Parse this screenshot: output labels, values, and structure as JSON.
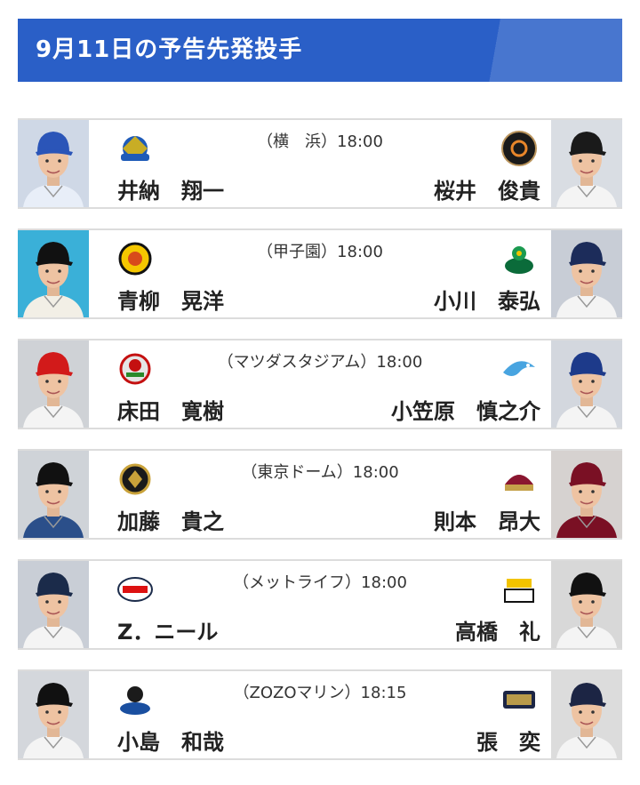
{
  "page_title": "9月11日の予告先発投手",
  "games": [
    {
      "venue": "（横　浜）18:00",
      "home_pitcher": "井納　翔一",
      "away_pitcher": "桜井　俊貴",
      "home_logo": "baystars-logo",
      "away_logo": "giants-logo",
      "home_colors": {
        "cap": "#2b55b8",
        "shirt": "#e8eef8",
        "bg": "#cfd8e6"
      },
      "away_colors": {
        "cap": "#1a1a1a",
        "shirt": "#f4f4f4",
        "bg": "#d9dde3"
      }
    },
    {
      "venue": "（甲子園）18:00",
      "home_pitcher": "青柳　晃洋",
      "away_pitcher": "小川　泰弘",
      "home_logo": "tigers-logo",
      "away_logo": "swallows-logo",
      "home_colors": {
        "cap": "#111111",
        "shirt": "#f2efe6",
        "bg": "#3ab0d8"
      },
      "away_colors": {
        "cap": "#1c2c5a",
        "shirt": "#f4f4f4",
        "bg": "#c8cdd6"
      }
    },
    {
      "venue": "（マツダスタジアム）18:00",
      "home_pitcher": "床田　寛樹",
      "away_pitcher": "小笠原　慎之介",
      "home_logo": "carp-logo",
      "away_logo": "dragons-logo",
      "home_colors": {
        "cap": "#d21a1a",
        "shirt": "#f4f4f4",
        "bg": "#cfd2d6"
      },
      "away_colors": {
        "cap": "#1d3a8a",
        "shirt": "#f4f4f4",
        "bg": "#d3d7de"
      }
    },
    {
      "venue": "（東京ドーム）18:00",
      "home_pitcher": "加藤　貴之",
      "away_pitcher": "則本　昂大",
      "home_logo": "fighters-logo",
      "away_logo": "eagles-logo",
      "home_colors": {
        "cap": "#111111",
        "shirt": "#2b4f8a",
        "bg": "#cfd3d8"
      },
      "away_colors": {
        "cap": "#7a1024",
        "shirt": "#7a1024",
        "bg": "#d6d2d0"
      }
    },
    {
      "venue": "（メットライフ）18:00",
      "home_pitcher": "Z．ニール",
      "away_pitcher": "高橋　礼",
      "home_logo": "lions-logo",
      "away_logo": "hawks-logo",
      "home_colors": {
        "cap": "#1b2b4a",
        "shirt": "#f4f4f4",
        "bg": "#c9ced6"
      },
      "away_colors": {
        "cap": "#111111",
        "shirt": "#f4f4f4",
        "bg": "#d8d8d8"
      }
    },
    {
      "venue": "（ZOZOマリン）18:15",
      "home_pitcher": "小島　和哉",
      "away_pitcher": "張　奕",
      "home_logo": "marines-logo",
      "away_logo": "buffaloes-logo",
      "home_colors": {
        "cap": "#111111",
        "shirt": "#f4f4f4",
        "bg": "#d4d7dc"
      },
      "away_colors": {
        "cap": "#1c2544",
        "shirt": "#f4f4f4",
        "bg": "#dcdcdc"
      }
    }
  ]
}
